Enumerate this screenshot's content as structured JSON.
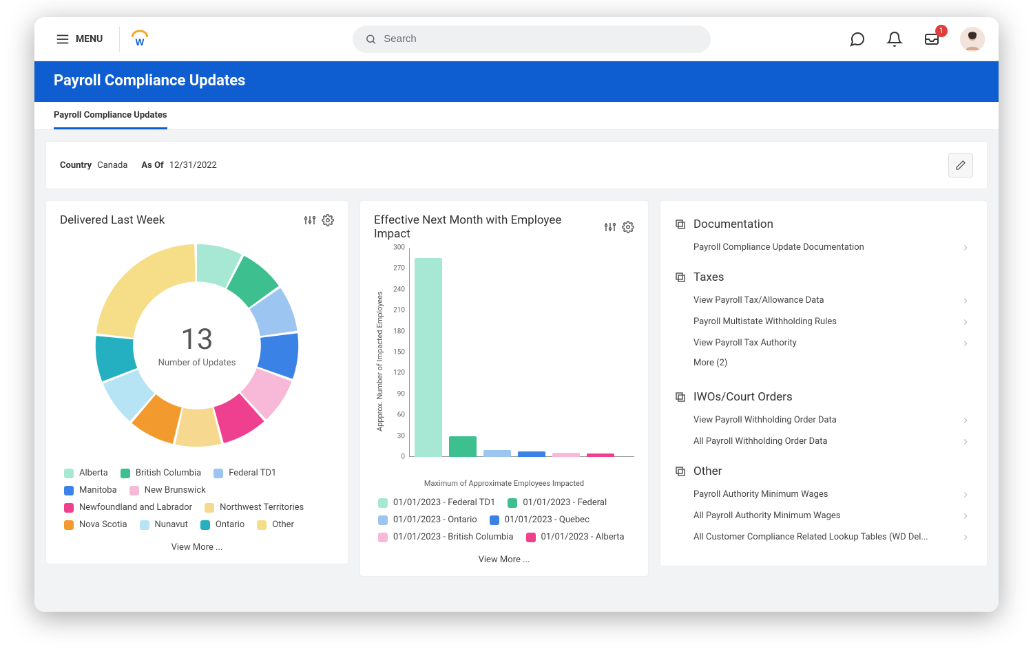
{
  "topbar": {
    "menu_label": "MENU",
    "search_placeholder": "Search",
    "inbox_badge": "1"
  },
  "header": {
    "title": "Payroll Compliance Updates"
  },
  "tabs": [
    {
      "label": "Payroll Compliance Updates"
    }
  ],
  "filters": {
    "country_label": "Country",
    "country_value": "Canada",
    "asof_label": "As Of",
    "asof_value": "12/31/2022"
  },
  "cards": {
    "delivered": {
      "title": "Delivered Last Week",
      "center_value": "13",
      "center_label": "Number of Updates",
      "view_more": "View More ..."
    },
    "effective": {
      "title": "Effective Next Month with Employee Impact",
      "y_axis_label": "Appprox. Number of Impacted Employees",
      "x_axis_label": "Maximum of Approximate Employees Impacted",
      "view_more": "View More ..."
    }
  },
  "right_panel": {
    "sections": [
      {
        "title": "Documentation",
        "links": [
          "Payroll Compliance Update Documentation"
        ]
      },
      {
        "title": "Taxes",
        "links": [
          "View Payroll Tax/Allowance Data",
          "Payroll Multistate Withholding Rules",
          "View Payroll Tax Authority"
        ],
        "more": "More (2)"
      },
      {
        "title": "IWOs/Court Orders",
        "links": [
          "View Payroll Withholding Order Data",
          "All Payroll Withholding Order Data"
        ]
      },
      {
        "title": "Other",
        "links": [
          "Payroll Authority Minimum Wages",
          "All Payroll Authority Minimum Wages",
          "All Customer Compliance Related Lookup Tables (WD Del..."
        ]
      }
    ]
  },
  "chart_data": [
    {
      "id": "delivered_donut",
      "type": "pie",
      "title": "Delivered Last Week",
      "center_value": 13,
      "center_label": "Number of Updates",
      "series": [
        {
          "name": "Alberta",
          "value": 1,
          "color": "#a7e8d4"
        },
        {
          "name": "British Columbia",
          "value": 1,
          "color": "#3dbf8f"
        },
        {
          "name": "Federal TD1",
          "value": 1,
          "color": "#9dc5f1"
        },
        {
          "name": "Manitoba",
          "value": 1,
          "color": "#3b82e6"
        },
        {
          "name": "New Brunswick",
          "value": 1,
          "color": "#f7b9d7"
        },
        {
          "name": "Newfoundland and Labrador",
          "value": 1,
          "color": "#ef3f8f"
        },
        {
          "name": "Northwest Territories",
          "value": 1,
          "color": "#f6d98f"
        },
        {
          "name": "Nova Scotia",
          "value": 1,
          "color": "#f39a2e"
        },
        {
          "name": "Nunavut",
          "value": 1,
          "color": "#b7e4f4"
        },
        {
          "name": "Ontario",
          "value": 1,
          "color": "#24b0c0"
        },
        {
          "name": "Other",
          "value": 3,
          "color": "#f6de88"
        }
      ]
    },
    {
      "id": "effective_bar",
      "type": "bar",
      "title": "Effective Next Month with Employee Impact",
      "xlabel": "Maximum of Approximate Employees Impacted",
      "ylabel": "Appprox. Number of Impacted Employees",
      "ylim": [
        0,
        300
      ],
      "yticks": [
        0,
        30,
        60,
        90,
        120,
        150,
        180,
        210,
        240,
        270,
        300
      ],
      "categories": [
        "01/01/2023 - Federal TD1",
        "01/01/2023 - Federal",
        "01/01/2023 - Ontario",
        "01/01/2023 - Quebec",
        "01/01/2023 - British Columbia",
        "01/01/2023 - Alberta"
      ],
      "values": [
        285,
        30,
        10,
        8,
        6,
        5
      ],
      "colors": [
        "#a7e8d4",
        "#3dbf8f",
        "#9dc5f1",
        "#3b82e6",
        "#f7b9d7",
        "#ef3f8f"
      ]
    }
  ]
}
